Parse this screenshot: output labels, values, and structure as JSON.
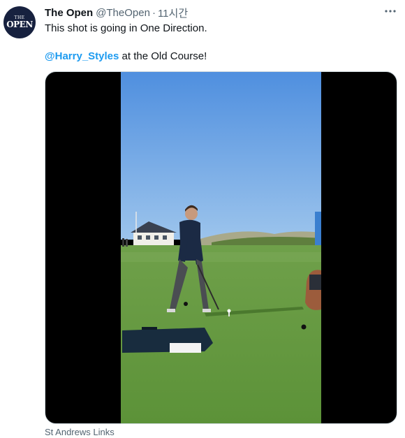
{
  "tweet": {
    "author": {
      "name": "The Open",
      "handle": "@TheOpen",
      "separator": "·",
      "time": "11시간",
      "avatar_line1": "THE",
      "avatar_line2": "OPEN"
    },
    "text_line1": "This shot is going in One Direction.",
    "mention": "@Harry_Styles",
    "text_line2_rest": " at the Old Course!",
    "location": "St Andrews Links",
    "icons": {
      "more": "more-options-icon",
      "avatar": "the-open-logo"
    },
    "colors": {
      "link": "#1d9bf0",
      "secondary": "#536471",
      "avatar_bg": "#17213f"
    }
  }
}
